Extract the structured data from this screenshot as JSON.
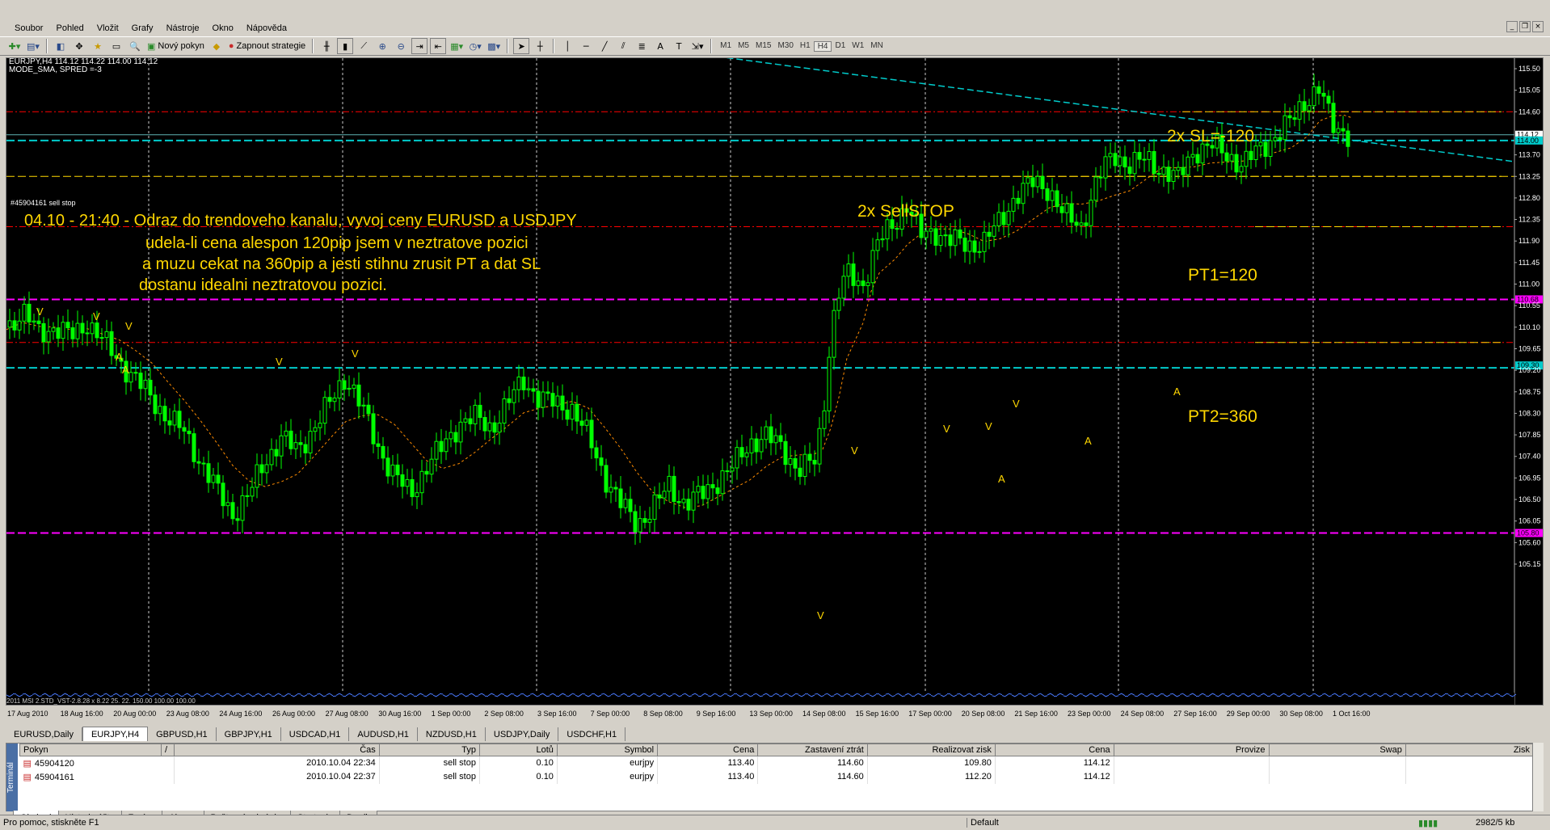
{
  "menu": [
    "Soubor",
    "Pohled",
    "Vložit",
    "Grafy",
    "Nástroje",
    "Okno",
    "Nápověda"
  ],
  "toolbar": {
    "new_order": "Nový pokyn",
    "enable_strategies": "Zapnout strategie",
    "timeframes": [
      "M1",
      "M5",
      "M15",
      "M30",
      "H1",
      "H4",
      "D1",
      "W1",
      "MN"
    ],
    "active_timeframe": "H4"
  },
  "chart": {
    "info_line1": "EURJPY,H4  114.12 114.22 114.00 114.12",
    "info_line2": "MODE_SMA, SPRED =-3",
    "order_label": "#45904161 sell stop",
    "indicator_label": "2011 MSI 2.STD_VST-2.8.28 x 8.22 25. 22. 150.00 100.00 100.00",
    "annotations": {
      "main_line1": "04.10 - 21:40 - Odraz do trendoveho kanalu, vyvoj ceny EURUSD a USDJPY",
      "main_line2": "udela-li cena alespon 120pip jsem v neztratove pozici",
      "main_line3": "a muzu cekat na 360pip a jesti stihnu zrusit PT a dat SL",
      "main_line4": "dostanu idealni neztratovou pozici.",
      "sl": "2x SL=-120",
      "sellstop": "2x SellSTOP",
      "pt1": "PT1=120",
      "pt2": "PT2=360"
    },
    "price_levels": [
      "115.50",
      "115.05",
      "114.60",
      "114.12",
      "114.00",
      "113.70",
      "113.25",
      "112.80",
      "112.35",
      "111.90",
      "111.45",
      "111.00",
      "110.68",
      "110.55",
      "110.10",
      "109.65",
      "109.30",
      "109.20",
      "108.75",
      "108.30",
      "107.85",
      "107.40",
      "106.95",
      "106.50",
      "106.05",
      "105.80",
      "105.60",
      "105.15"
    ],
    "time_labels": [
      "17 Aug 2010",
      "18 Aug 16:00",
      "20 Aug 00:00",
      "23 Aug 08:00",
      "24 Aug 16:00",
      "26 Aug 00:00",
      "27 Aug 08:00",
      "30 Aug 16:00",
      "1 Sep 00:00",
      "2 Sep 08:00",
      "3 Sep 16:00",
      "7 Sep 00:00",
      "8 Sep 08:00",
      "9 Sep 16:00",
      "13 Sep 00:00",
      "14 Sep 08:00",
      "15 Sep 16:00",
      "17 Sep 00:00",
      "20 Sep 08:00",
      "21 Sep 16:00",
      "23 Sep 00:00",
      "24 Sep 08:00",
      "27 Sep 16:00",
      "29 Sep 00:00",
      "30 Sep 08:00",
      "1 Oct 16:00"
    ],
    "colors": {
      "up": "#00ff00",
      "down": "#ffffff",
      "annotation": "#ffd700",
      "red_line": "#ff0000",
      "magenta_line": "#ff00ff",
      "cyan_line": "#00cccc",
      "yellow_line": "#ffd700",
      "ma": "#ff8c00"
    }
  },
  "symbol_tabs": [
    "EURUSD,Daily",
    "EURJPY,H4",
    "GBPUSD,H1",
    "GBPJPY,H1",
    "USDCAD,H1",
    "AUDUSD,H1",
    "NZDUSD,H1",
    "USDJPY,Daily",
    "USDCHF,H1"
  ],
  "active_symbol_tab": "EURJPY,H4",
  "terminal": {
    "side_label": "Terminál",
    "headers": [
      "Pokyn",
      "/",
      "Čas",
      "Typ",
      "Lotů",
      "Symbol",
      "Cena",
      "Zastavení ztrát",
      "Realizovat zisk",
      "Cena",
      "Provize",
      "Swap",
      "Zisk"
    ],
    "rows": [
      [
        "45904120",
        "2010.10.04 22:34",
        "sell stop",
        "0.10",
        "eurjpy",
        "113.40",
        "114.60",
        "109.80",
        "114.12",
        "",
        "",
        ""
      ],
      [
        "45904161",
        "2010.10.04 22:37",
        "sell stop",
        "0.10",
        "eurjpy",
        "113.40",
        "114.60",
        "112.20",
        "114.12",
        "",
        "",
        ""
      ]
    ],
    "tabs": [
      "Obchod",
      "Historie účtu",
      "Zprávy",
      "Alarmy",
      "Poštovní schránka",
      "Strategie",
      "Deník"
    ],
    "active_tab": "Obchod"
  },
  "status": {
    "help": "Pro pomoc, stiskněte F1",
    "profile": "Default",
    "traffic": "2982/5 kb"
  }
}
